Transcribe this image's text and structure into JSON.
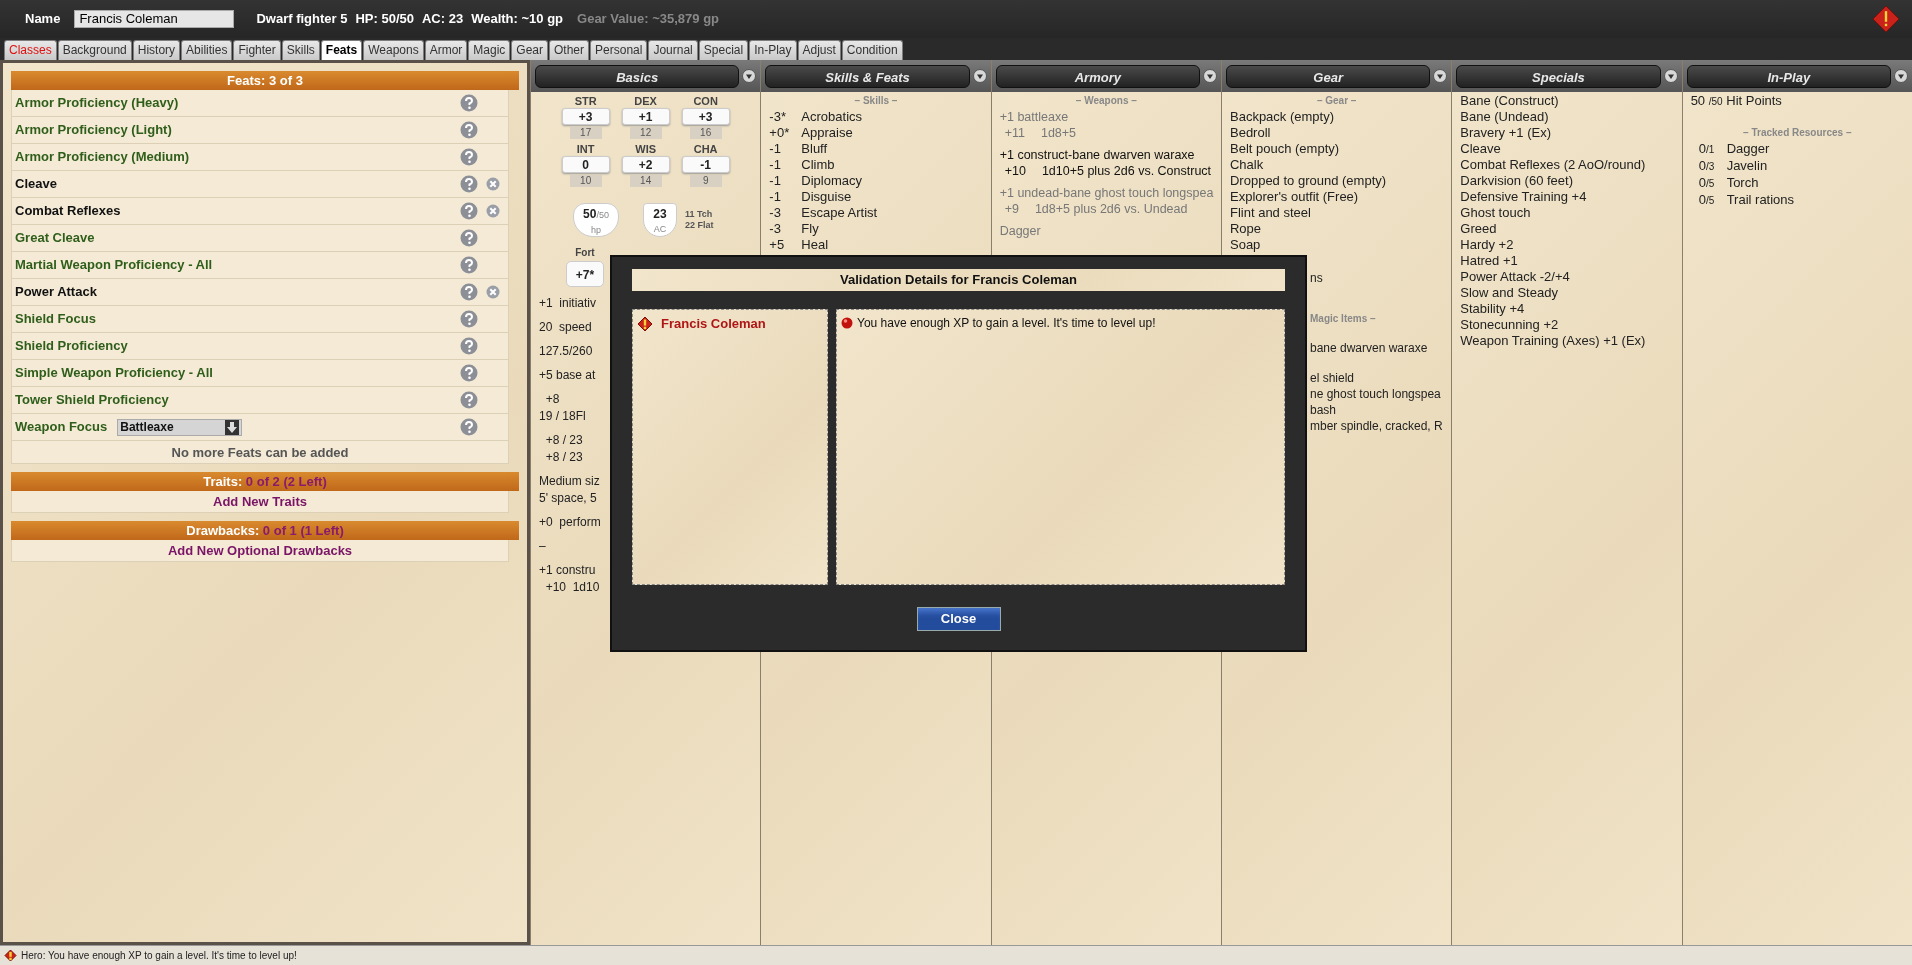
{
  "header": {
    "name_label": "Name",
    "name_value": "Francis Coleman",
    "summary": [
      "Dwarf fighter 5",
      "HP: 50/50",
      "AC: 23",
      "Wealth: ~10 gp"
    ],
    "gear_value": "Gear Value: ~35,879 gp"
  },
  "tabs": [
    {
      "label": "Classes",
      "selected": false,
      "flagged": true
    },
    {
      "label": "Background",
      "selected": false,
      "flagged": false
    },
    {
      "label": "History",
      "selected": false,
      "flagged": false
    },
    {
      "label": "Abilities",
      "selected": false,
      "flagged": false
    },
    {
      "label": "Fighter",
      "selected": false,
      "flagged": false
    },
    {
      "label": "Skills",
      "selected": false,
      "flagged": false
    },
    {
      "label": "Feats",
      "selected": true,
      "flagged": false
    },
    {
      "label": "Weapons",
      "selected": false,
      "flagged": false
    },
    {
      "label": "Armor",
      "selected": false,
      "flagged": false
    },
    {
      "label": "Magic",
      "selected": false,
      "flagged": false
    },
    {
      "label": "Gear",
      "selected": false,
      "flagged": false
    },
    {
      "label": "Other",
      "selected": false,
      "flagged": false
    },
    {
      "label": "Personal",
      "selected": false,
      "flagged": false
    },
    {
      "label": "Journal",
      "selected": false,
      "flagged": false
    },
    {
      "label": "Special",
      "selected": false,
      "flagged": false
    },
    {
      "label": "In-Play",
      "selected": false,
      "flagged": false
    },
    {
      "label": "Adjust",
      "selected": false,
      "flagged": false
    },
    {
      "label": "Condition",
      "selected": false,
      "flagged": false
    }
  ],
  "feats": {
    "title": "Feats: 3 of 3",
    "items": [
      {
        "name": "Armor Proficiency (Heavy)",
        "kind": "granted",
        "removable": false
      },
      {
        "name": "Armor Proficiency (Light)",
        "kind": "granted",
        "removable": false
      },
      {
        "name": "Armor Proficiency (Medium)",
        "kind": "granted",
        "removable": false
      },
      {
        "name": "Cleave",
        "kind": "chosen",
        "removable": true
      },
      {
        "name": "Combat Reflexes",
        "kind": "chosen",
        "removable": true
      },
      {
        "name": "Great Cleave",
        "kind": "granted",
        "removable": false
      },
      {
        "name": "Martial Weapon Proficiency - All",
        "kind": "granted",
        "removable": false
      },
      {
        "name": "Power Attack",
        "kind": "chosen",
        "removable": true
      },
      {
        "name": "Shield Focus",
        "kind": "granted",
        "removable": false
      },
      {
        "name": "Shield Proficiency",
        "kind": "granted",
        "removable": false
      },
      {
        "name": "Simple Weapon Proficiency - All",
        "kind": "granted",
        "removable": false
      },
      {
        "name": "Tower Shield Proficiency",
        "kind": "granted",
        "removable": false
      },
      {
        "name": "Weapon Focus",
        "kind": "choice",
        "removable": false,
        "value": "Battleaxe"
      }
    ],
    "note": "No more Feats can be added"
  },
  "traits": {
    "label": "Traits:",
    "count": "0 of 2 (2 Left)",
    "add": "Add New Traits"
  },
  "drawbacks": {
    "label": "Drawbacks:",
    "count": "0 of 1 (1 Left)",
    "add": "Add New Optional Drawbacks"
  },
  "basics": {
    "title": "Basics",
    "abilities": [
      {
        "name": "STR",
        "modifier": "+3",
        "score": "17"
      },
      {
        "name": "DEX",
        "modifier": "+1",
        "score": "12"
      },
      {
        "name": "CON",
        "modifier": "+3",
        "score": "16"
      },
      {
        "name": "INT",
        "modifier": "0",
        "score": "10"
      },
      {
        "name": "WIS",
        "modifier": "+2",
        "score": "14"
      },
      {
        "name": "CHA",
        "modifier": "-1",
        "score": "9"
      }
    ],
    "hp": {
      "value": "50",
      "max": "/50",
      "label": "hp"
    },
    "ac": {
      "value": "23",
      "label": "AC"
    },
    "touch": "11 Tch",
    "flat": "22 Flat",
    "save": {
      "label": "Fort",
      "value": "+7*"
    },
    "line_groups": [
      [
        "+1  initiativ"
      ],
      [
        "20  speed"
      ],
      [
        "127.5/260"
      ],
      [
        "+5 base at"
      ],
      [
        "  +8",
        "19 / 18Fl"
      ],
      [
        "  +8 / 23",
        "  +8 / 23"
      ],
      [
        "Medium siz",
        "5' space, 5"
      ],
      [
        "+0  perform"
      ],
      [
        "–"
      ],
      [
        "+1 constru",
        "  +10  1d10"
      ]
    ]
  },
  "skills": {
    "title": "Skills & Feats",
    "section": "– Skills –",
    "items": [
      {
        "modifier": "-3*",
        "name": "Acrobatics"
      },
      {
        "modifier": "+0*",
        "name": "Appraise"
      },
      {
        "modifier": "-1",
        "name": "Bluff"
      },
      {
        "modifier": "-1",
        "name": "Climb"
      },
      {
        "modifier": "-1",
        "name": "Diplomacy"
      },
      {
        "modifier": "-1",
        "name": "Disguise"
      },
      {
        "modifier": "-3",
        "name": "Escape Artist"
      },
      {
        "modifier": "-3",
        "name": "Fly"
      },
      {
        "modifier": "+5",
        "name": "Heal"
      }
    ]
  },
  "armory": {
    "title": "Armory",
    "section": "– Weapons –",
    "weapons": [
      {
        "name": "+1 battleaxe",
        "attack": "+11",
        "damage": "1d8+5",
        "equipped": false
      },
      {
        "name": "+1 construct-bane dwarven waraxe",
        "attack": "+10",
        "damage": "1d10+5 plus 2d6 vs. Construct",
        "equipped": true
      },
      {
        "name": "+1 undead-bane ghost touch longspea",
        "attack": "+9",
        "damage": "1d8+5 plus 2d6 vs. Undead",
        "equipped": false
      },
      {
        "name": "Dagger",
        "equipped": false
      }
    ]
  },
  "gear": {
    "title": "Gear",
    "section": "– Gear –",
    "items": [
      "Backpack (empty)",
      "Bedroll",
      "Belt pouch (empty)",
      "Chalk",
      "Dropped to ground (empty)",
      "Explorer's outfit (Free)",
      "Flint and steel",
      "Rope",
      "Soap"
    ],
    "cut_items": [
      "ns"
    ],
    "magic_section": "Magic Items –",
    "magic_groups": [
      [
        "bane dwarven waraxe"
      ],
      [
        "el shield",
        "ne ghost touch longspea",
        "bash",
        "mber spindle, cracked, R"
      ]
    ]
  },
  "specials": {
    "title": "Specials",
    "items": [
      "Bane (Construct)",
      "Bane (Undead)",
      "Bravery +1 (Ex)",
      "Cleave",
      "Combat Reflexes (2 AoO/round)",
      "Darkvision (60 feet)",
      "Defensive Training +4",
      "Ghost touch",
      "Greed",
      "Hardy +2",
      "Hatred +1",
      "Power Attack -2/+4",
      "Slow and Steady",
      "Stability +4",
      "Stonecunning +2",
      "Weapon Training (Axes) +1 (Ex)"
    ]
  },
  "in_play": {
    "title": "In-Play",
    "hp": {
      "current": "50",
      "max": "/50",
      "label": "Hit Points"
    },
    "section": "– Tracked Resources –",
    "resources": [
      {
        "used": "0",
        "max": "/1",
        "name": "Dagger"
      },
      {
        "used": "0",
        "max": "/3",
        "name": "Javelin"
      },
      {
        "used": "0",
        "max": "/5",
        "name": "Torch"
      },
      {
        "used": "0",
        "max": "/5",
        "name": "Trail rations"
      }
    ]
  },
  "dialog": {
    "title": "Validation Details for Francis Coleman",
    "entities": [
      {
        "name": "Francis Coleman"
      }
    ],
    "messages": [
      "You have enough XP to gain a level. It's time to level up!"
    ],
    "close": "Close"
  },
  "status_bar": {
    "text": "Hero: You have enough XP to gain a level. It's time to level up!"
  }
}
